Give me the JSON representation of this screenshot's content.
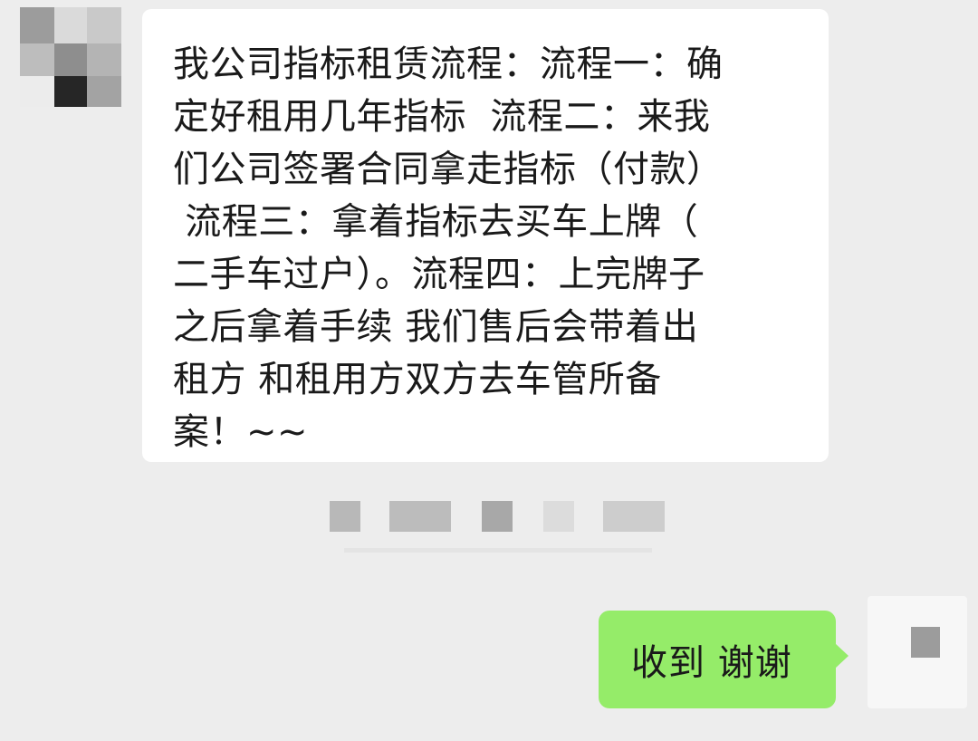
{
  "chat": {
    "incoming_message": "我公司指标租赁流程：流程一：确\n定好租用几年指标  流程二：来我\n们公司签署合同拿走指标（付款）\n 流程三：拿着指标去买车上牌（\n二手车过户）。流程四：上完牌子\n之后拿着手续 我们售后会带着出\n租方 和租用方双方去车管所备\n案！~~",
    "outgoing_message": "收到 谢谢",
    "incoming_bubble_color": "#ffffff",
    "outgoing_bubble_color": "#95ec69",
    "background_color": "#ededed"
  }
}
